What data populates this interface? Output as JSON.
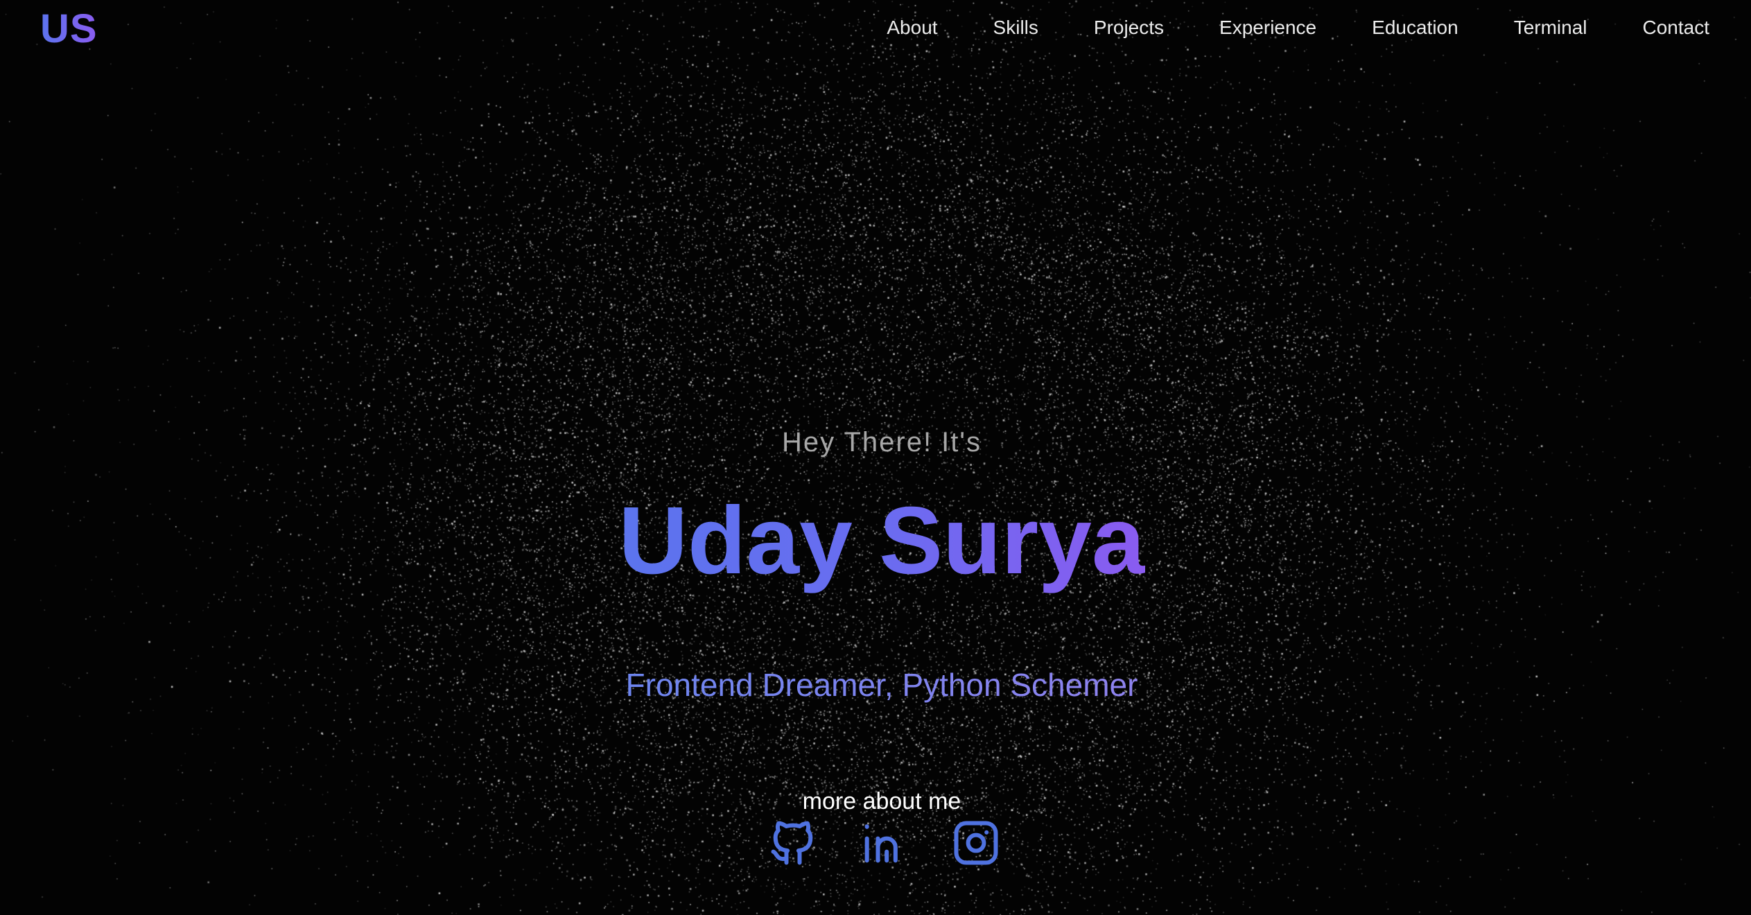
{
  "header": {
    "logo": "US",
    "nav": [
      "About",
      "Skills",
      "Projects",
      "Experience",
      "Education",
      "Terminal",
      "Contact"
    ]
  },
  "hero": {
    "greeting": "Hey There! It's",
    "name": "Uday Surya",
    "tagline": "Frontend Dreamer, Python Schemer",
    "more_label": "more about me"
  },
  "socials": [
    {
      "icon": "github-icon"
    },
    {
      "icon": "linkedin-icon"
    },
    {
      "icon": "instagram-icon"
    }
  ],
  "colors": {
    "background": "#030303",
    "accent_start": "#5b74ee",
    "accent_end": "#8b5cf0",
    "icon": "#4f72e0",
    "nav_text": "#ececec",
    "greeting_text": "#a7a7a7"
  }
}
